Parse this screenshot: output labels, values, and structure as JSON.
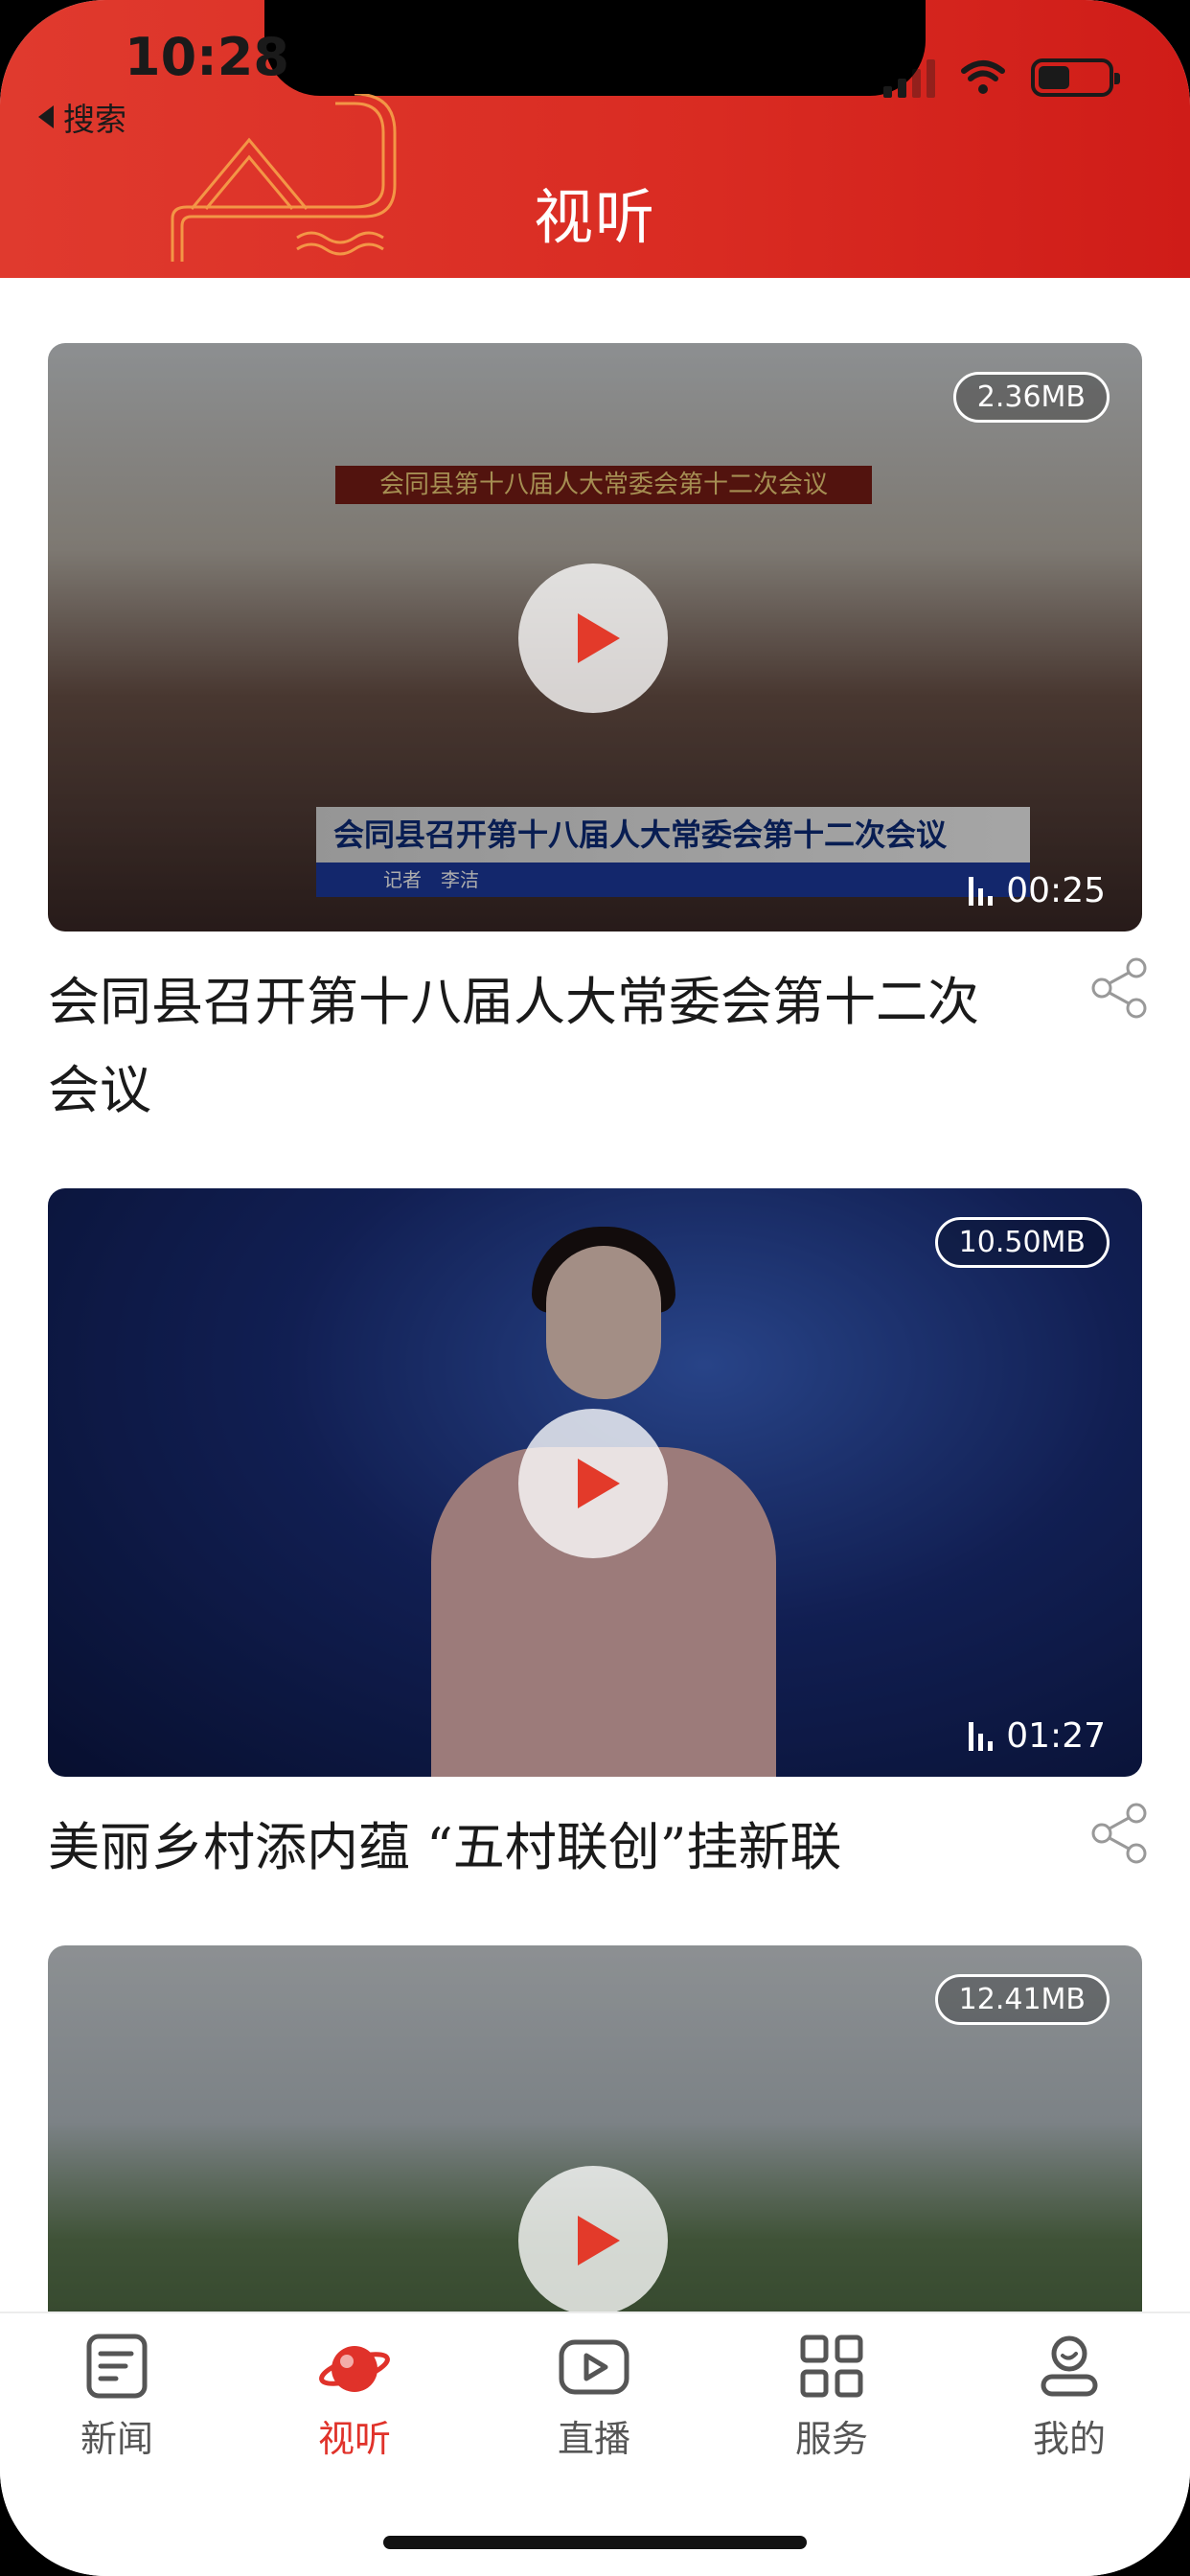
{
  "status_bar": {
    "time": "10:28",
    "back_label": "搜索"
  },
  "header": {
    "title": "视听"
  },
  "videos": [
    {
      "title": "会同县召开第十八届人大常委会第十二次会议",
      "size": "2.36MB",
      "duration": "00:25",
      "banner": "会同县第十八届人大常委会第十二次会议",
      "caption": "会同县召开第十八届人大常委会第十二次会议",
      "reporter": "记者　李洁"
    },
    {
      "title": "美丽乡村添内蕴 “五村联创”挂新联",
      "size": "10.50MB",
      "duration": "01:27"
    },
    {
      "size": "12.41MB"
    }
  ],
  "tabs": [
    {
      "label": "新闻",
      "icon": "news-icon"
    },
    {
      "label": "视听",
      "icon": "planet-icon",
      "active": true
    },
    {
      "label": "直播",
      "icon": "play-icon"
    },
    {
      "label": "服务",
      "icon": "grid-icon"
    },
    {
      "label": "我的",
      "icon": "user-icon"
    }
  ],
  "colors": {
    "brand_red": "#d92b22",
    "play_red": "#e33a2a",
    "tab_active": "#e0322a"
  }
}
